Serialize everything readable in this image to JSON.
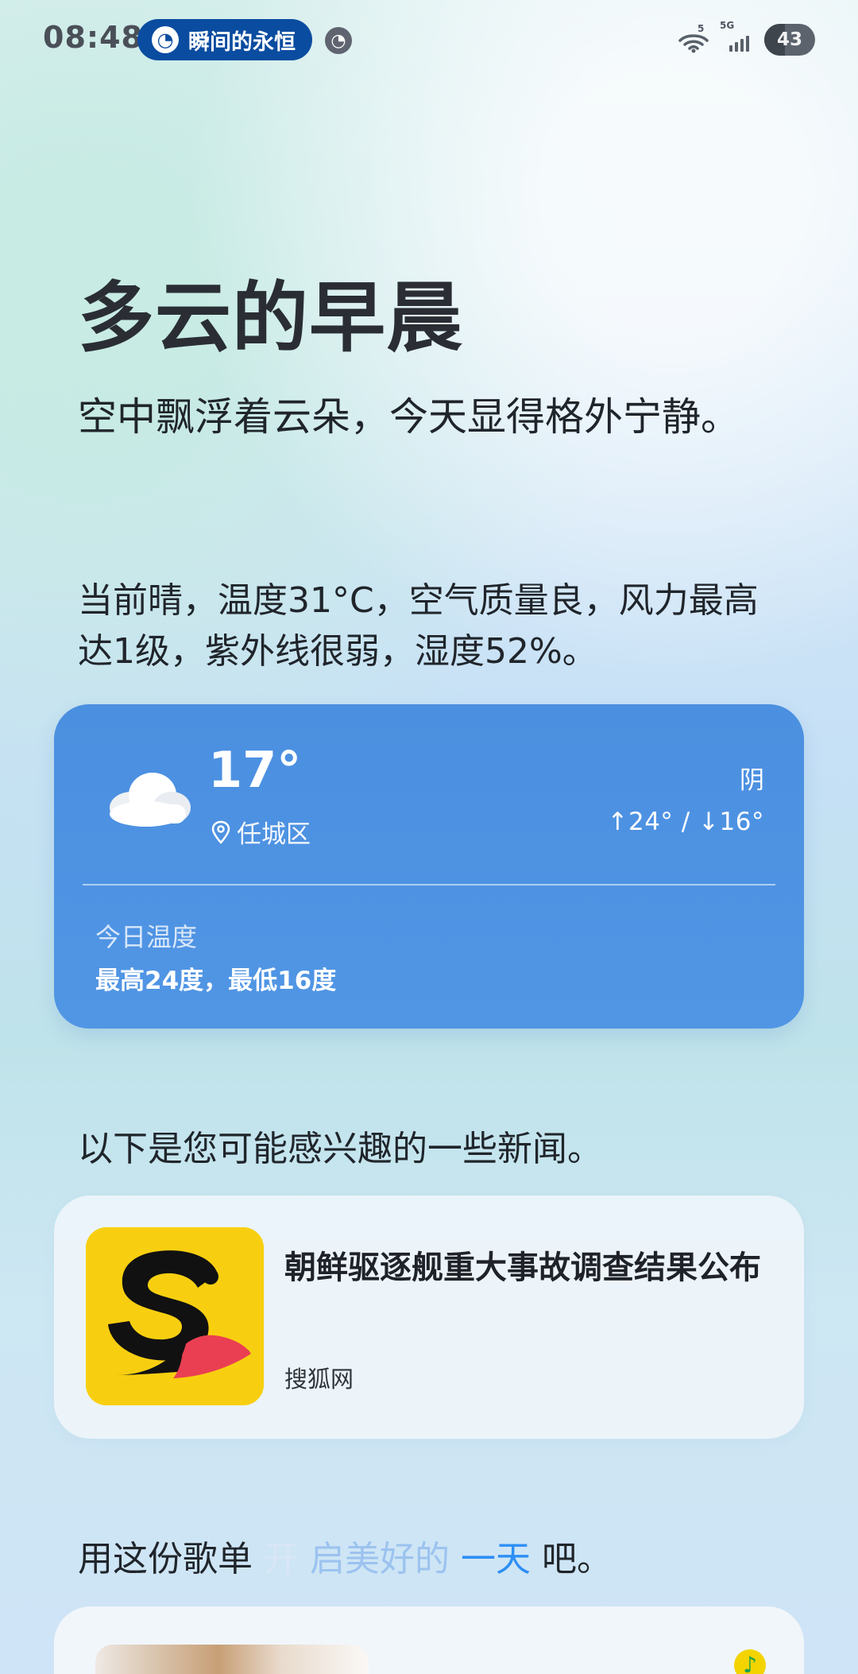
{
  "status_bar": {
    "time": "08:48",
    "pill_text": "瞬间的永恒",
    "wifi_label": "5",
    "network_label": "5G",
    "battery": "43"
  },
  "hero": {
    "title": "多云的早晨",
    "subtitle": "空中飘浮着云朵，今天显得格外宁静。",
    "weather_summary": "当前晴，温度31°C，空气质量良，风力最高达1级，紫外线很弱，湿度52%。"
  },
  "weather_card": {
    "temperature": "17°",
    "location": "任城区",
    "condition": "阴",
    "range": "↑24° / ↓16°",
    "today_label": "今日温度",
    "today_value": "最高24度，最低16度",
    "icon": "cloud-icon"
  },
  "news": {
    "intro": "以下是您可能感兴趣的一些新闻。",
    "title": "朝鲜驱逐舰重大事故调查结果公布",
    "source": "搜狐网",
    "thumbnail": "sohu-fox-logo"
  },
  "playlist": {
    "segments": [
      "用这份歌单",
      "开",
      "启美好的",
      "一天",
      "吧。"
    ],
    "icon": "music-note-icon"
  }
}
